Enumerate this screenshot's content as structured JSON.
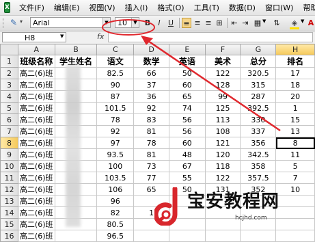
{
  "menubar": {
    "items": [
      "文件(F)",
      "编辑(E)",
      "视图(V)",
      "插入(I)",
      "格式(O)",
      "工具(T)",
      "数据(D)",
      "窗口(W)",
      "帮助(H)"
    ]
  },
  "toolbar": {
    "font_name": "Arial",
    "font_size": "10",
    "bold": "B",
    "italic": "I",
    "underline": "U"
  },
  "formula_bar": {
    "name_box": "H8",
    "fx_label": "fx",
    "value": ""
  },
  "columns": [
    "A",
    "B",
    "C",
    "D",
    "E",
    "F",
    "G",
    "H"
  ],
  "header_row": [
    "班级名称",
    "学生姓名",
    "语文",
    "数学",
    "英语",
    "美术",
    "总分",
    "排名"
  ],
  "rows": [
    [
      "高二(6)班",
      "",
      "82.5",
      "66",
      "50",
      "122",
      "320.5",
      "17"
    ],
    [
      "高二(6)班",
      "",
      "90",
      "37",
      "60",
      "128",
      "315",
      "18"
    ],
    [
      "高二(6)班",
      "",
      "87",
      "36",
      "65",
      "99",
      "287",
      "20"
    ],
    [
      "高二(6)班",
      "",
      "101.5",
      "92",
      "74",
      "125",
      "392.5",
      "1"
    ],
    [
      "高二(6)班",
      "",
      "78",
      "83",
      "56",
      "113",
      "330",
      "15"
    ],
    [
      "高二(6)班",
      "",
      "92",
      "81",
      "56",
      "108",
      "337",
      "13"
    ],
    [
      "高二(6)班",
      "",
      "97",
      "78",
      "60",
      "121",
      "356",
      "8"
    ],
    [
      "高二(6)班",
      "",
      "93.5",
      "81",
      "48",
      "120",
      "342.5",
      "11"
    ],
    [
      "高二(6)班",
      "",
      "100",
      "73",
      "67",
      "118",
      "358",
      "5"
    ],
    [
      "高二(6)班",
      "",
      "103.5",
      "77",
      "55",
      "122",
      "357.5",
      "7"
    ],
    [
      "高二(6)班",
      "",
      "106",
      "65",
      "50",
      "131",
      "352",
      "10"
    ],
    [
      "高二(6)班",
      "",
      "96",
      "",
      "",
      "",
      "",
      ""
    ],
    [
      "高二(6)班",
      "",
      "82",
      "1",
      "",
      "",
      "",
      ""
    ],
    [
      "高二(6)班",
      "",
      "80.5",
      "",
      "",
      "",
      "",
      ""
    ],
    [
      "高二(6)班",
      "",
      "96.5",
      "",
      "",
      "",
      "",
      ""
    ]
  ],
  "watermark": {
    "title": "宝安教程网",
    "url": "hcjhd.com"
  },
  "colors": {
    "annotation": "#e0282e",
    "selection": "#f5c95a"
  }
}
